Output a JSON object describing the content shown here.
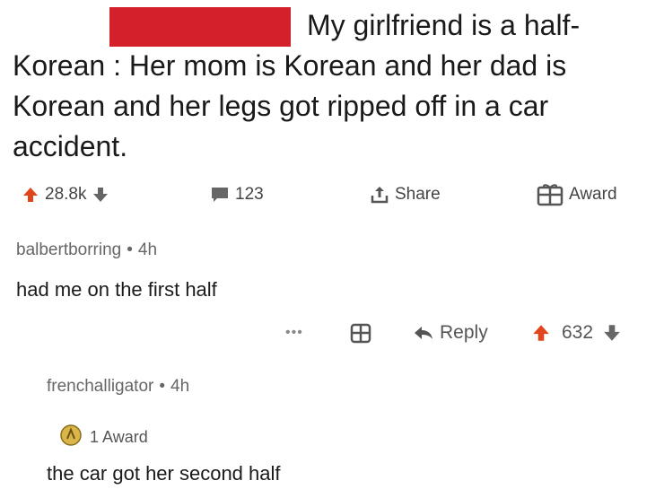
{
  "post": {
    "title": "My girlfriend is a half-Korean : Her mom is Korean and her dad is Korean and her legs got ripped off in a car accident.",
    "upvotes": "28.8k",
    "comments": "123",
    "share_label": "Share",
    "award_label": "Award"
  },
  "comment1": {
    "user": "balbertborring",
    "age": "4h",
    "body": "had me on the first half",
    "more_label": "•••",
    "reply_label": "Reply",
    "score": "632"
  },
  "comment2": {
    "user": "frenchalligator",
    "age": "4h",
    "award_label": "1 Award",
    "body": "the car got her second half"
  },
  "colors": {
    "upvote": "#e0461e",
    "text": "#1a1a1b",
    "muted": "#666666",
    "redaction": "#d4202a"
  }
}
